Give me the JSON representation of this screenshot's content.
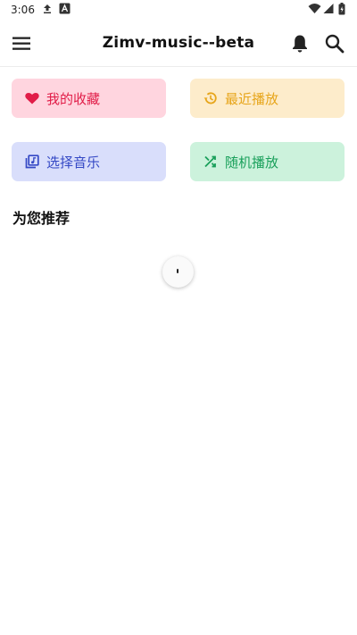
{
  "status_bar": {
    "time": "3:06"
  },
  "app_bar": {
    "title": "Zimv-music--beta"
  },
  "quick_actions": [
    {
      "label": "我的收藏",
      "color": "#e11d48",
      "bg": "#ffd5df",
      "icon": "heart-icon"
    },
    {
      "label": "最近播放",
      "color": "#e7a51a",
      "bg": "#fdeccb",
      "icon": "history-icon"
    },
    {
      "label": "选择音乐",
      "color": "#3448c5",
      "bg": "#d9defb",
      "icon": "music-library-icon"
    },
    {
      "label": "随机播放",
      "color": "#1aa05b",
      "bg": "#ccf2dc",
      "icon": "shuffle-icon"
    }
  ],
  "recommend": {
    "title": "为您推荐"
  }
}
